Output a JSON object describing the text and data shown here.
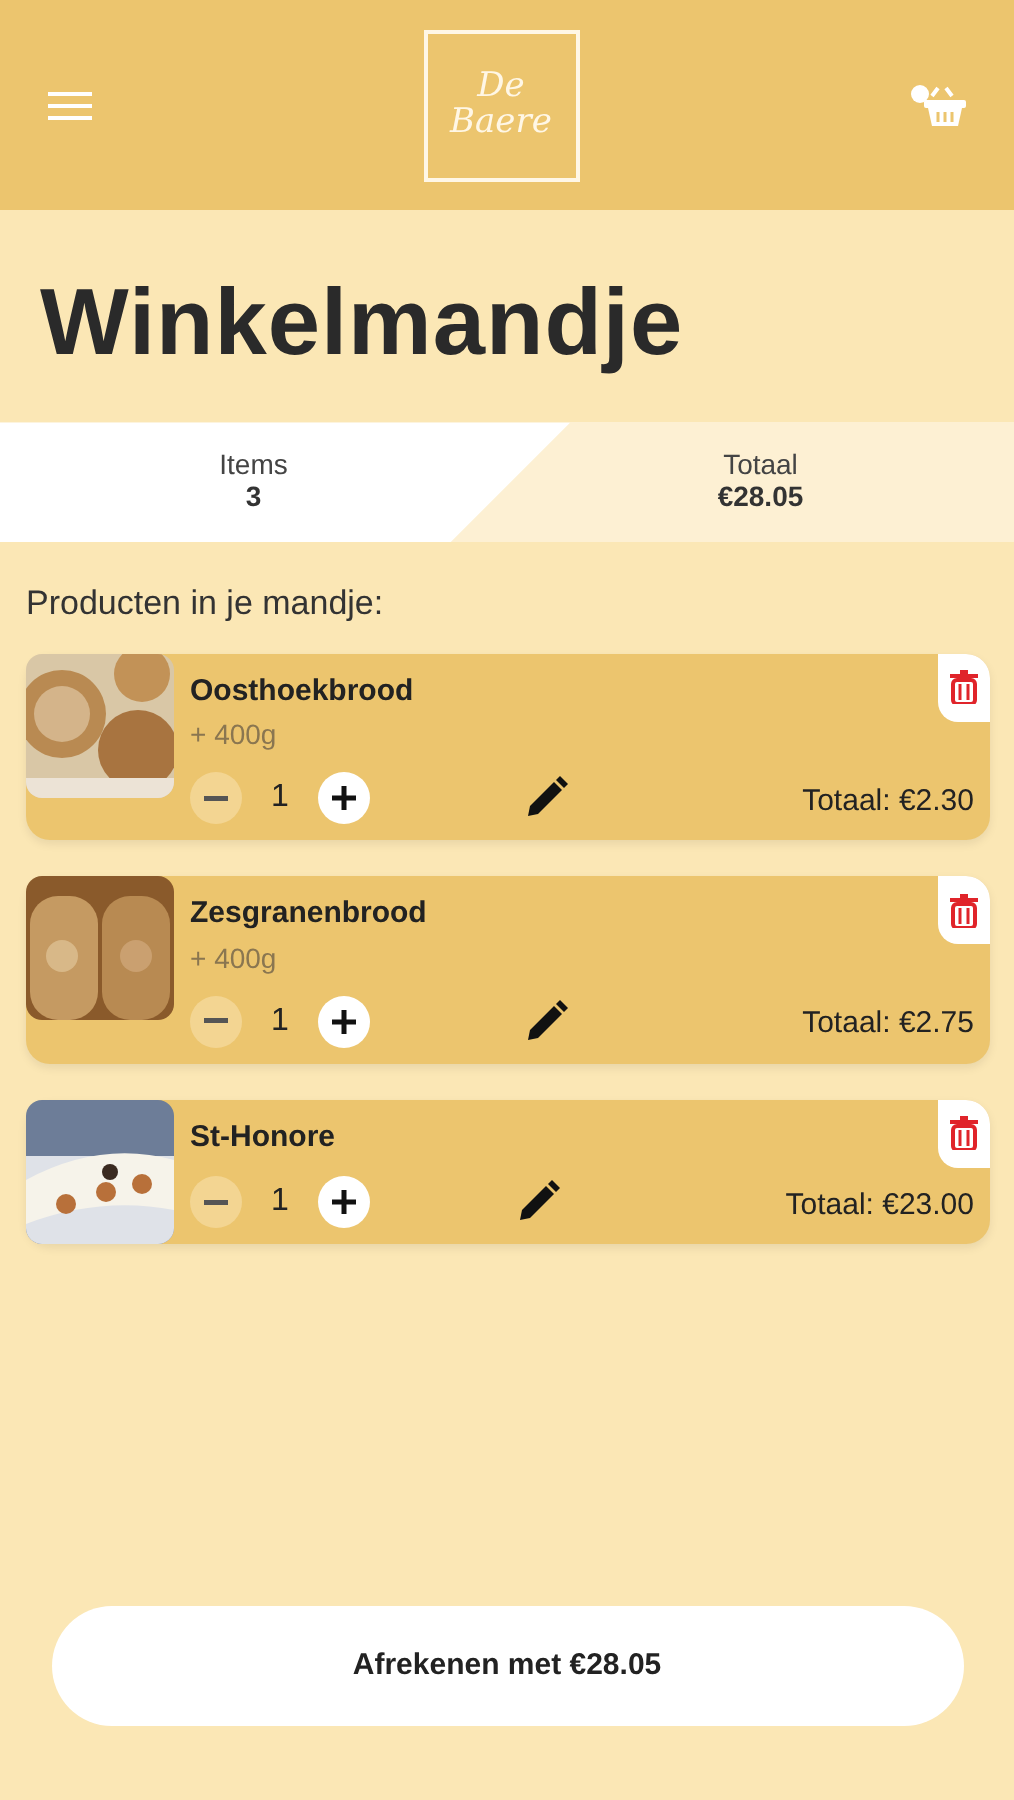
{
  "header": {
    "logo": "De Baere"
  },
  "title": "Winkelmandje",
  "summary": [
    {
      "label": "Items",
      "value": "3"
    },
    {
      "label": "Totaal",
      "value": "€28.05"
    }
  ],
  "section_label": "Producten in je mandje:",
  "products": [
    {
      "name": "Oosthoekbrood",
      "option": "+ 400g",
      "quantity": "1",
      "minus_disabled": true,
      "total": "Totaal: €2.30"
    },
    {
      "name": "Zesgranenbrood",
      "option": "+ 400g",
      "quantity": "1",
      "minus_disabled": true,
      "total": "Totaal: €2.75"
    },
    {
      "name": "St-Honore",
      "quantity": "1",
      "minus_disabled": true,
      "total": "Totaal: €23.00"
    }
  ],
  "checkout_button": "Afrekenen met €28.05"
}
